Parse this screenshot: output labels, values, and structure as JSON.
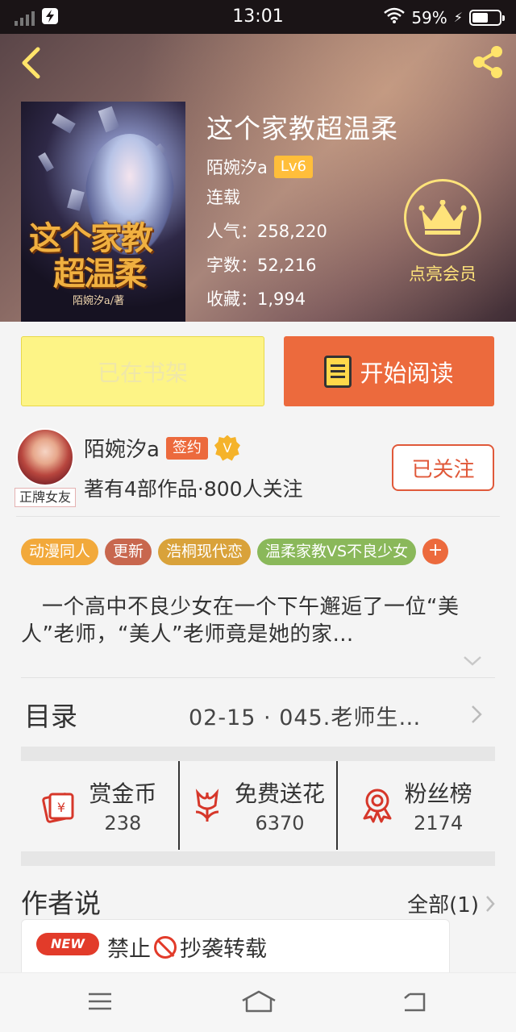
{
  "status_bar": {
    "time": "13:01",
    "battery": "59%",
    "battery_level": 0.59
  },
  "book": {
    "title": "这个家教超温柔",
    "author": "陌婉汐a",
    "level": "Lv6",
    "status": "连载",
    "popularity": "人气：258,220",
    "word_count": "字数：52,216",
    "favorites": "收藏：1,994",
    "cover_title_line1": "这个家教",
    "cover_title_line2": "超温柔",
    "cover_author": "陌婉汐a/著"
  },
  "vip": {
    "label": "点亮会员"
  },
  "actions": {
    "shelf_label": "已在书架",
    "read_label": "开始阅读"
  },
  "author": {
    "name": "陌婉汐a",
    "sign_badge": "签约",
    "verified_badge": "V",
    "stats": "著有4部作品·800人关注",
    "avatar_tag": "正牌女友",
    "follow_label": "已关注"
  },
  "tags": [
    {
      "label": "动漫同人",
      "color": "#f2a93b"
    },
    {
      "label": "更新",
      "color": "#c8674e"
    },
    {
      "label": "浩桐现代恋",
      "color": "#d9a23a"
    },
    {
      "label": "温柔家教VS不良少女",
      "color": "#8ab85a"
    }
  ],
  "tag_more": "+",
  "synopsis": "一个高中不良少女在一个下午邂逅了一位“美人”老师，“美人”老师竟是她的家…",
  "toc": {
    "label": "目录",
    "latest": "02-15 · 045.老师生…"
  },
  "stats": [
    {
      "label": "赏金币",
      "value": "238",
      "icon": "red-envelope-icon"
    },
    {
      "label": "免费送花",
      "value": "6370",
      "icon": "flower-icon"
    },
    {
      "label": "粉丝榜",
      "value": "2174",
      "icon": "medal-icon"
    }
  ],
  "author_notes": {
    "label": "作者说",
    "all": "全部(1)",
    "new_badge": "NEW",
    "note_prefix": "禁止",
    "note_suffix": "抄袭转载"
  },
  "colors": {
    "accent": "#ec6a3d",
    "shelf_button": "#fdf486",
    "vip_gold": "#ffe37a"
  }
}
